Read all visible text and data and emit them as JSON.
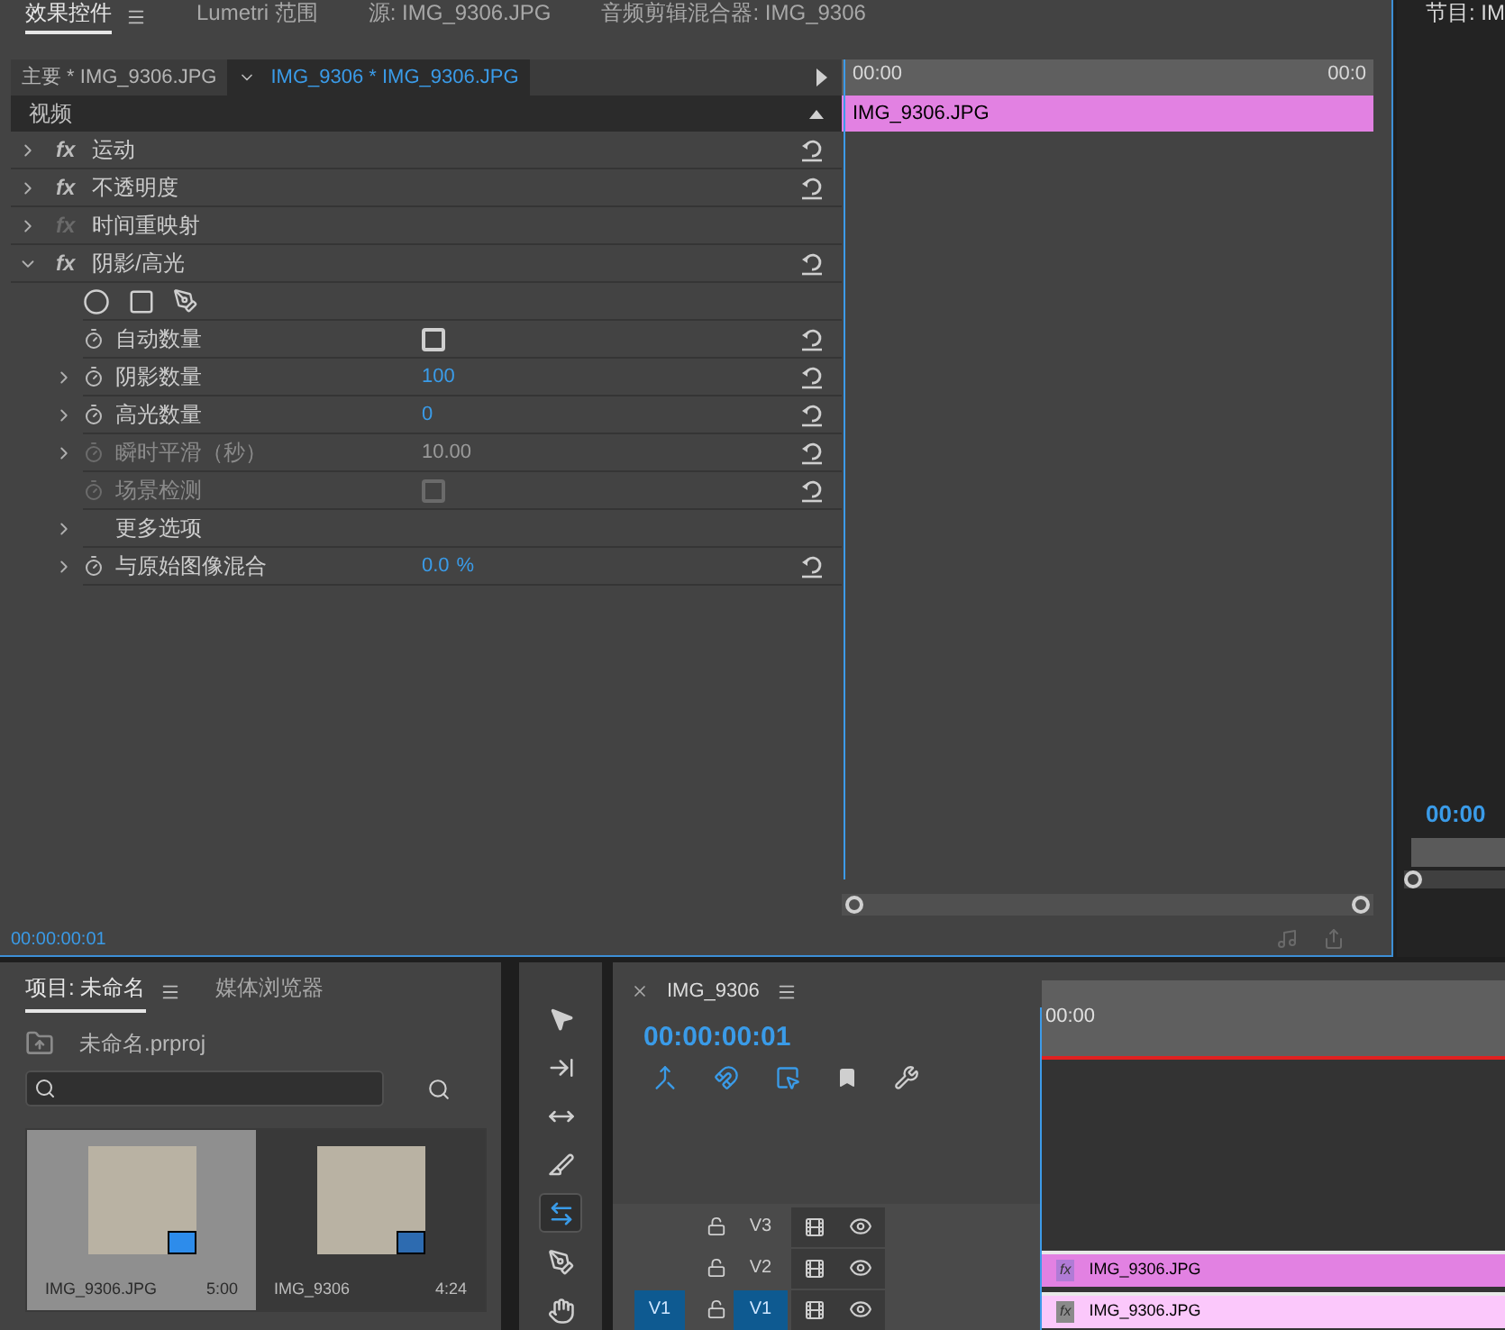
{
  "top_tabs": [
    {
      "label": "效果控件",
      "selected": true
    },
    {
      "label": "Lumetri 范围",
      "selected": false
    },
    {
      "label": "源: IMG_9306.JPG",
      "selected": false
    },
    {
      "label": "音频剪辑混合器: IMG_9306",
      "selected": false
    }
  ],
  "effect_controls": {
    "clip_tabs": [
      {
        "label": "主要 * IMG_9306.JPG",
        "selected": false
      },
      {
        "label": "IMG_9306 * IMG_9306.JPG",
        "selected": true
      }
    ],
    "section": "视频",
    "effects": [
      {
        "name": "运动",
        "badge": "fx",
        "badge_enabled": true,
        "expanded": false,
        "resettable": true
      },
      {
        "name": "不透明度",
        "badge": "fx",
        "badge_enabled": true,
        "expanded": false,
        "resettable": true
      },
      {
        "name": "时间重映射",
        "badge": "fx",
        "badge_enabled": false,
        "expanded": false,
        "resettable": false
      },
      {
        "name": "阴影/高光",
        "badge": "fx",
        "badge_enabled": true,
        "expanded": true,
        "resettable": true,
        "params": [
          {
            "kind": "checkbox",
            "name": "自动数量",
            "checked": false,
            "disabled": false
          },
          {
            "kind": "value",
            "name": "阴影数量",
            "value": "100",
            "disabled": false,
            "expanded": false
          },
          {
            "kind": "value",
            "name": "高光数量",
            "value": "0",
            "disabled": false,
            "expanded": false
          },
          {
            "kind": "value",
            "name": "瞬时平滑（秒）",
            "value": "10.00",
            "disabled": true,
            "expanded": false
          },
          {
            "kind": "checkbox",
            "name": "场景检测",
            "checked": false,
            "disabled": true
          },
          {
            "kind": "group",
            "name": "更多选项",
            "expanded": false
          },
          {
            "kind": "value",
            "name": "与原始图像混合",
            "value": "0.0",
            "unit": "%",
            "disabled": false,
            "expanded": false
          }
        ]
      }
    ],
    "ruler": [
      "00:00",
      "00:0"
    ],
    "clip": "IMG_9306.JPG",
    "timecode": "00:00:00:01"
  },
  "program": {
    "title": "节目: IM",
    "timecode": "00:00"
  },
  "project": {
    "tabs": [
      {
        "label": "项目: 未命名",
        "selected": true
      },
      {
        "label": "媒体浏览器",
        "selected": false
      }
    ],
    "file": "未命名.prproj",
    "items": [
      {
        "name": "IMG_9306.JPG",
        "duration": "5:00",
        "kind": "clip",
        "selected": true
      },
      {
        "name": "IMG_9306",
        "duration": "4:24",
        "kind": "sequence",
        "selected": false
      }
    ]
  },
  "tools": [
    {
      "kind": "selection",
      "selected": false
    },
    {
      "kind": "track-select",
      "selected": false
    },
    {
      "kind": "ripple",
      "selected": false
    },
    {
      "kind": "razor",
      "selected": false
    },
    {
      "kind": "slip",
      "selected": true
    },
    {
      "kind": "pen",
      "selected": false
    },
    {
      "kind": "hand",
      "selected": false
    }
  ],
  "sequence": {
    "title": "IMG_9306",
    "timecode": "00:00:00:01",
    "ruler": "00:00",
    "tracks": [
      {
        "label": "V3",
        "targeted": false
      },
      {
        "label": "V2",
        "targeted": false,
        "clip": {
          "name": "IMG_9306.JPG",
          "badge": "fx",
          "badge_enabled": true,
          "selected": false
        }
      },
      {
        "label": "V1",
        "source_label": "V1",
        "targeted": true,
        "clip": {
          "name": "IMG_9306.JPG",
          "badge": "fx",
          "badge_enabled": false,
          "selected": true
        }
      }
    ]
  }
}
